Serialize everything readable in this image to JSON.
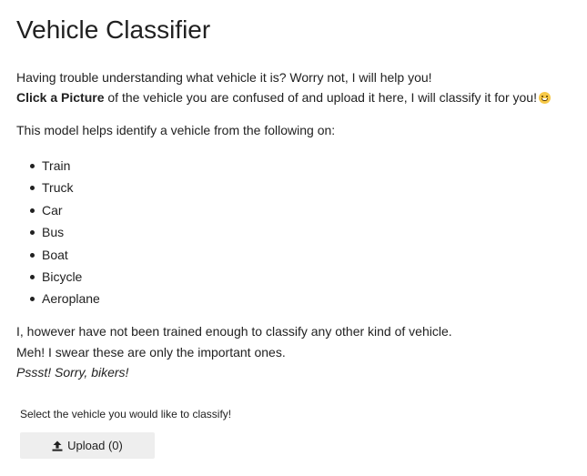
{
  "page": {
    "title": "Vehicle Classifier",
    "intro_line1": "Having trouble understanding what vehicle it is? Worry not, I will help you!",
    "intro_line2_bold": "Click a Picture",
    "intro_line2_rest": " of the vehicle you are confused of and upload it here, I will classify it for you!",
    "intro_emoji": "grinning-squinting-face-emoji",
    "model_text": "This model helps identify a vehicle from the following on:",
    "vehicles": [
      "Train",
      "Truck",
      "Car",
      "Bus",
      "Boat",
      "Bicycle",
      "Aeroplane"
    ],
    "outro_line1": "I, however have not been trained enough to classify any other kind of vehicle.",
    "outro_line2": "Meh! I swear these are only the important ones.",
    "outro_line3": "Pssst! Sorry, bikers!"
  },
  "uploader": {
    "label": "Select the vehicle you would like to classify!",
    "button_label": "Upload (0)",
    "button_icon": "upload-icon"
  },
  "colors": {
    "text": "#212121",
    "button_bg": "#eeeeee",
    "emoji": "#f7c948"
  }
}
